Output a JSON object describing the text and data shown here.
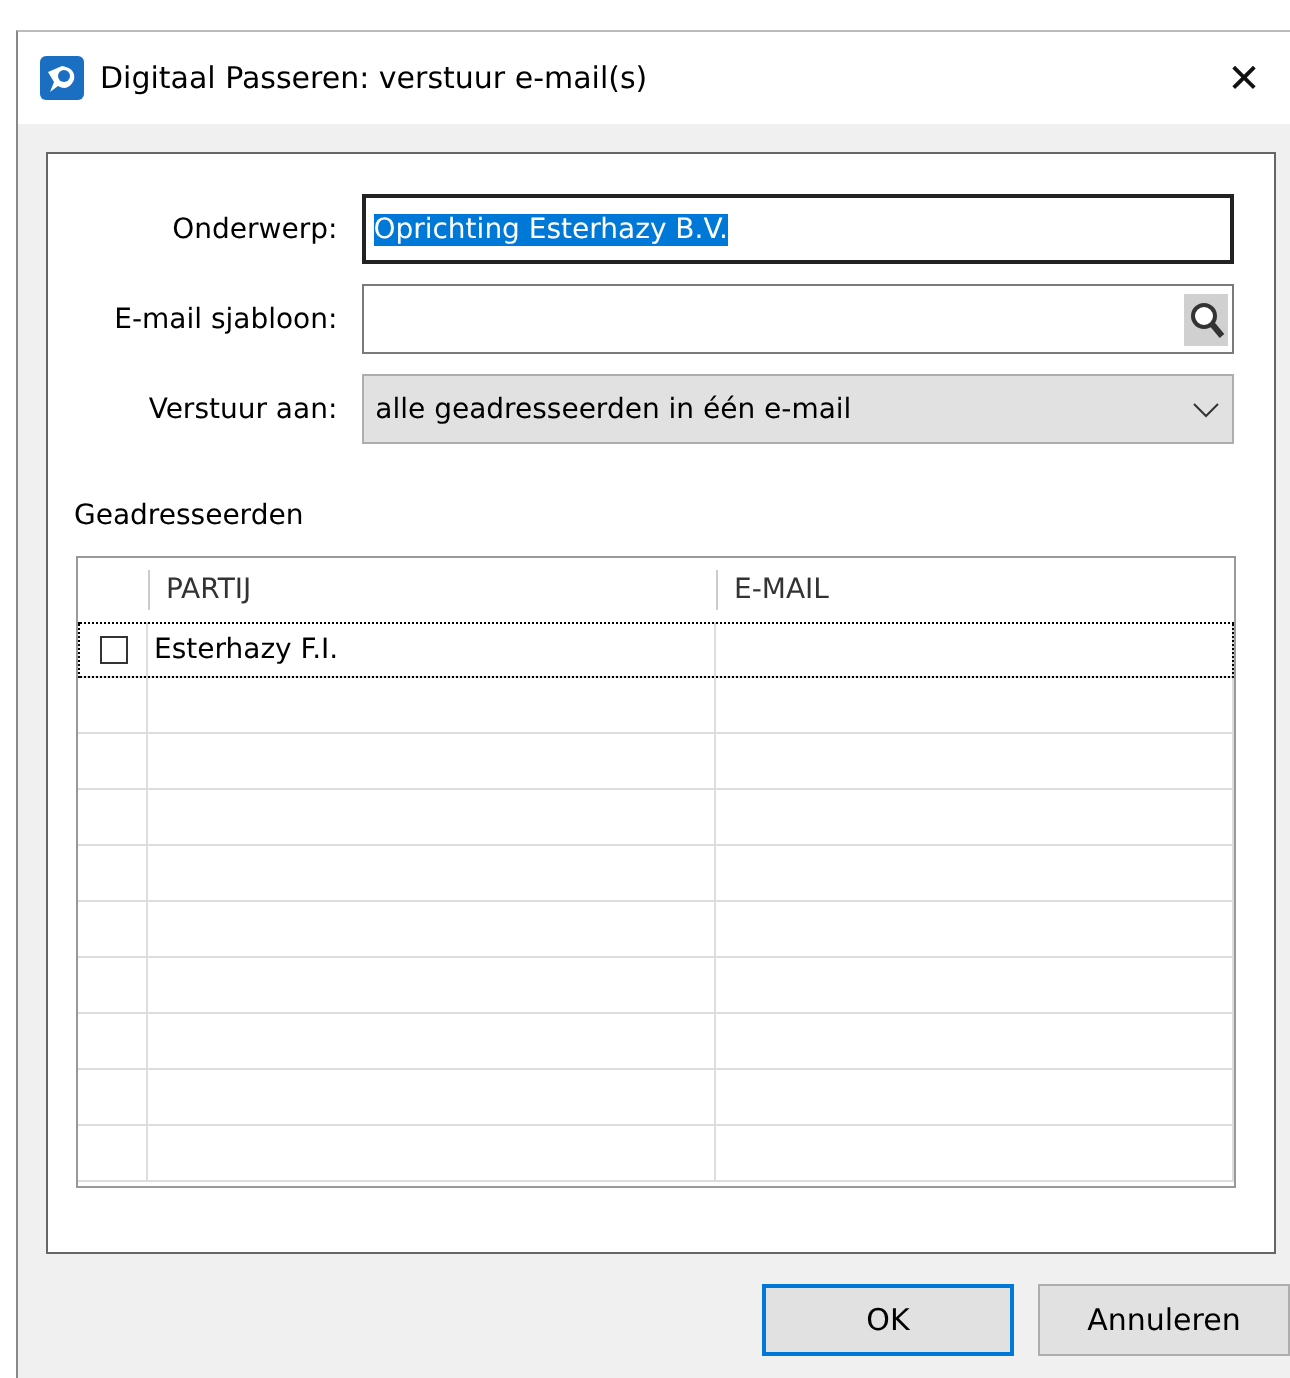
{
  "window": {
    "title": "Digitaal Passeren: verstuur e-mail(s)",
    "close": "✕"
  },
  "form": [
    {
      "kind": "text",
      "label": "Onderwerp:",
      "value": "Oprichting Esterhazy B.V.",
      "value_selected": true
    },
    {
      "kind": "lookup",
      "label": "E-mail sjabloon:"
    },
    {
      "kind": "dropdown",
      "label": "Verstuur aan:",
      "value": "alle geadresseerden in één e-mail"
    }
  ],
  "section_title": "Geadresseerden",
  "table": {
    "columns": [
      "PARTIJ",
      "E-MAIL"
    ],
    "rows": [
      {
        "checked": false,
        "selected": true,
        "cells": [
          "Esterhazy F.I."
        ]
      }
    ]
  },
  "buttons": [
    {
      "label": "OK",
      "default": true
    },
    {
      "label": "Annuleren",
      "default": false
    }
  ]
}
